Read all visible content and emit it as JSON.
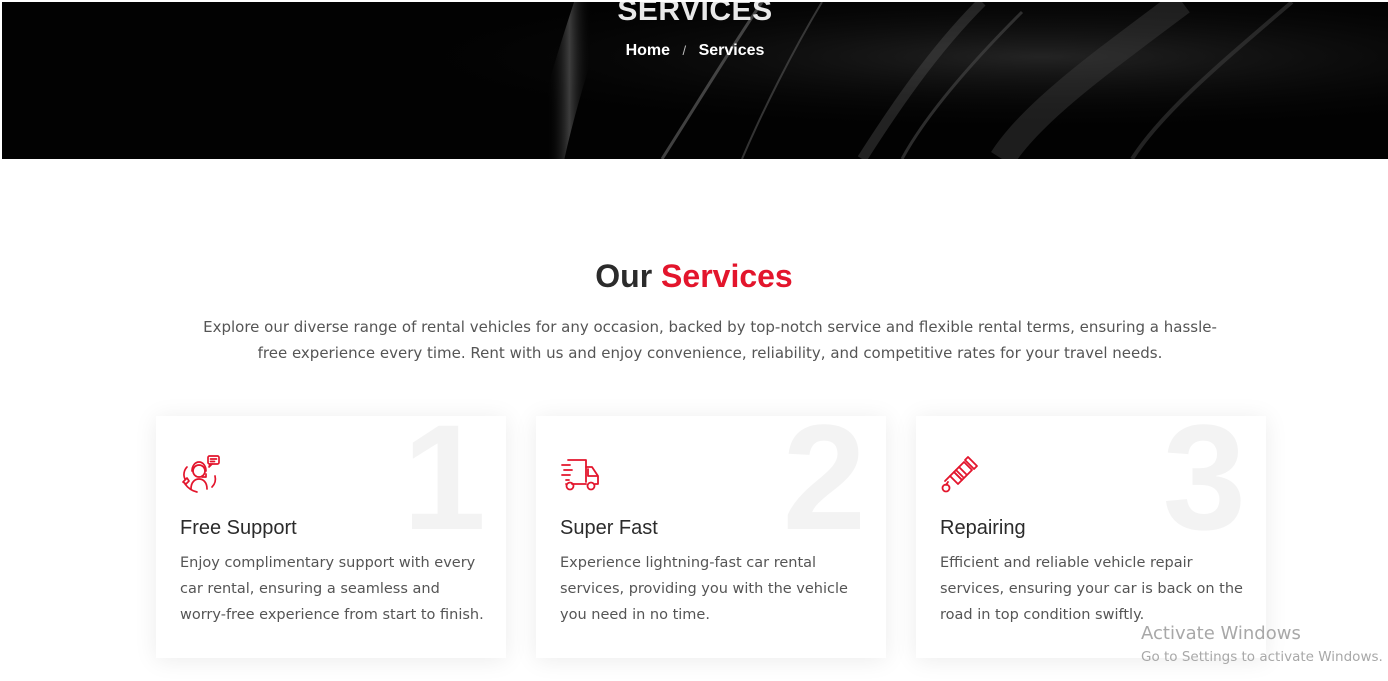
{
  "hero": {
    "title": "SERVICES",
    "breadcrumb": {
      "home": "Home",
      "separator": "/",
      "current": "Services"
    }
  },
  "section": {
    "title_plain": "Our",
    "title_accent": "Services",
    "accent_color": "#e3152c",
    "description": "Explore our diverse range of rental vehicles for any occasion, backed by top-notch service and flexible rental terms, ensuring a hassle-free experience every time. Rent with us and enjoy convenience, reliability, and competitive rates for your travel needs."
  },
  "cards": [
    {
      "number": "1",
      "icon": "support-agent-icon",
      "title": "Free Support",
      "description": "Enjoy complimentary support with every car rental, ensuring a seamless and worry-free experience from start to finish."
    },
    {
      "number": "2",
      "icon": "delivery-truck-icon",
      "title": "Super Fast",
      "description": "Experience lightning-fast car rental services, providing you with the vehicle you need in no time."
    },
    {
      "number": "3",
      "icon": "spark-plug-icon",
      "title": "Repairing",
      "description": "Efficient and reliable vehicle repair services, ensuring your car is back on the road in top condition swiftly."
    }
  ],
  "os_watermark": {
    "title": "Activate Windows",
    "subtitle": "Go to Settings to activate Windows."
  }
}
